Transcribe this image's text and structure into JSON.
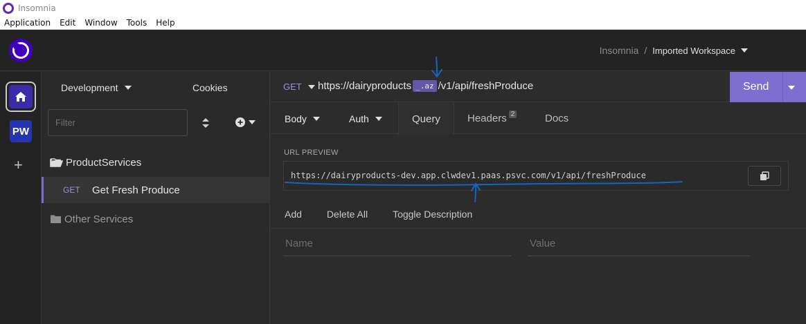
{
  "window": {
    "title": "Insomnia"
  },
  "menu": [
    "Application",
    "Edit",
    "Window",
    "Tools",
    "Help"
  ],
  "header": {
    "app_name": "Insomnia",
    "separator": "/",
    "workspace": "Imported Workspace"
  },
  "rail": {
    "workspace_initials": "PW"
  },
  "sidebar": {
    "environment": "Development",
    "cookies": "Cookies",
    "filter_placeholder": "Filter",
    "folders": [
      {
        "name": "ProductServices",
        "open": true
      },
      {
        "name": "Other Services",
        "open": false
      }
    ],
    "request": {
      "method": "GET",
      "name": "Get Fresh Produce"
    }
  },
  "request": {
    "method": "GET",
    "url_prefix": "https://dairyproducts",
    "url_variable": "_.az",
    "url_suffix": "/v1/api/freshProduce",
    "send_label": "Send"
  },
  "tabs": {
    "body": "Body",
    "auth": "Auth",
    "query": "Query",
    "headers": "Headers",
    "headers_count": "2",
    "docs": "Docs"
  },
  "query": {
    "preview_label": "URL PREVIEW",
    "preview_url": "https://dairyproducts-dev.app.clwdev1.paas.psvc.com/v1/api/freshProduce",
    "add": "Add",
    "delete_all": "Delete All",
    "toggle_description": "Toggle Description",
    "name_placeholder": "Name",
    "value_placeholder": "Value"
  },
  "colors": {
    "accent": "#7e6ed0",
    "method": "#9d8ee0",
    "annotation": "#1565c0"
  }
}
